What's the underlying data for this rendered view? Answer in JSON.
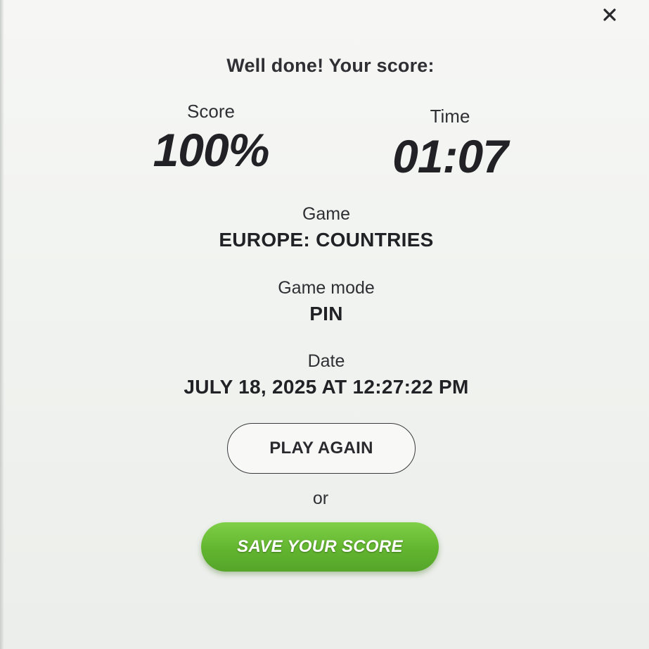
{
  "modal": {
    "heading": "Well done! Your score:",
    "score": {
      "label": "Score",
      "value": "100%"
    },
    "time": {
      "label": "Time",
      "value": "01:07"
    },
    "game": {
      "label": "Game",
      "value": "EUROPE: COUNTRIES"
    },
    "mode": {
      "label": "Game mode",
      "value": "PIN"
    },
    "date": {
      "label": "Date",
      "value": "JULY 18, 2025 AT 12:27:22 PM"
    },
    "play_again_label": "PLAY AGAIN",
    "or_text": "or",
    "save_label": "SAVE YOUR SCORE",
    "close_icon": "close-icon"
  },
  "colors": {
    "accent_green": "#62b52f",
    "text_dark": "#222226",
    "background": "#f3f4f2"
  }
}
